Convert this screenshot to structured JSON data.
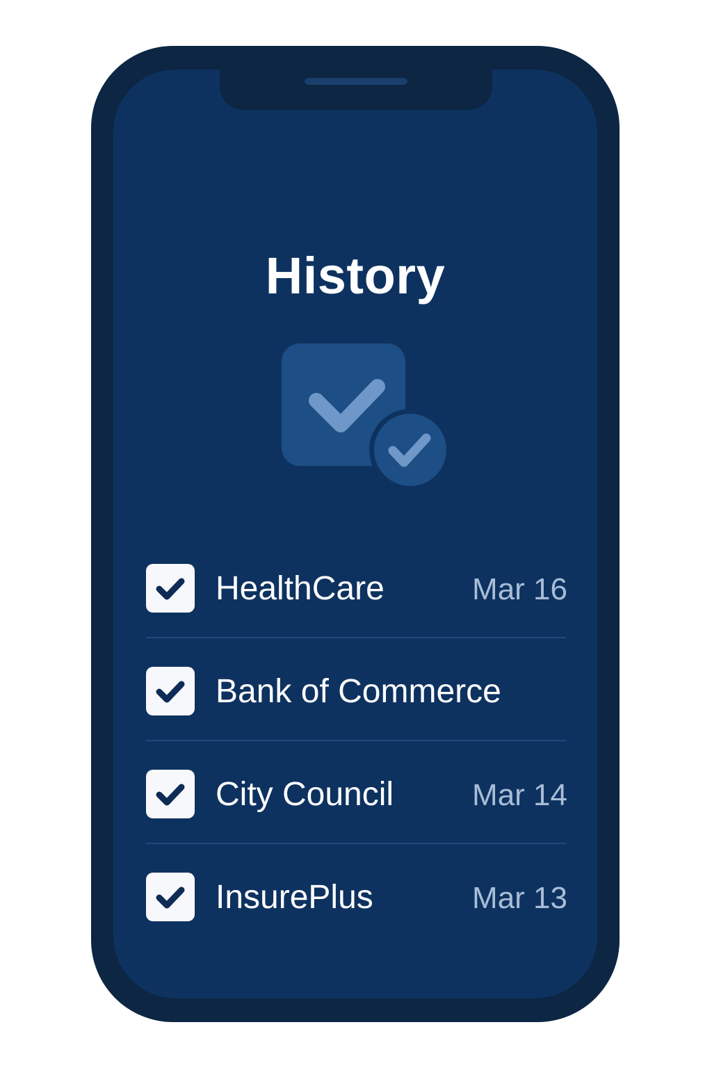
{
  "screen": {
    "title": "History"
  },
  "history": {
    "items": [
      {
        "label": "HealthCare",
        "date": "Mar 16",
        "checked": true
      },
      {
        "label": "Bank of Commerce",
        "date": "",
        "checked": true
      },
      {
        "label": "City Council",
        "date": "Mar 14",
        "checked": true
      },
      {
        "label": "InsurePlus",
        "date": "Mar 13",
        "checked": true
      }
    ]
  },
  "icons": {
    "hero": "double-check-icon",
    "row_check": "checkbox-checked-icon"
  },
  "colors": {
    "frame": "#0c2643",
    "screen_bg": "#0e3260",
    "title_text": "#ffffff",
    "date_text": "#a8bdd6",
    "divider": "#20497c",
    "checkbox_bg": "#f7f8fb",
    "checkmark": "#0e2c55"
  }
}
